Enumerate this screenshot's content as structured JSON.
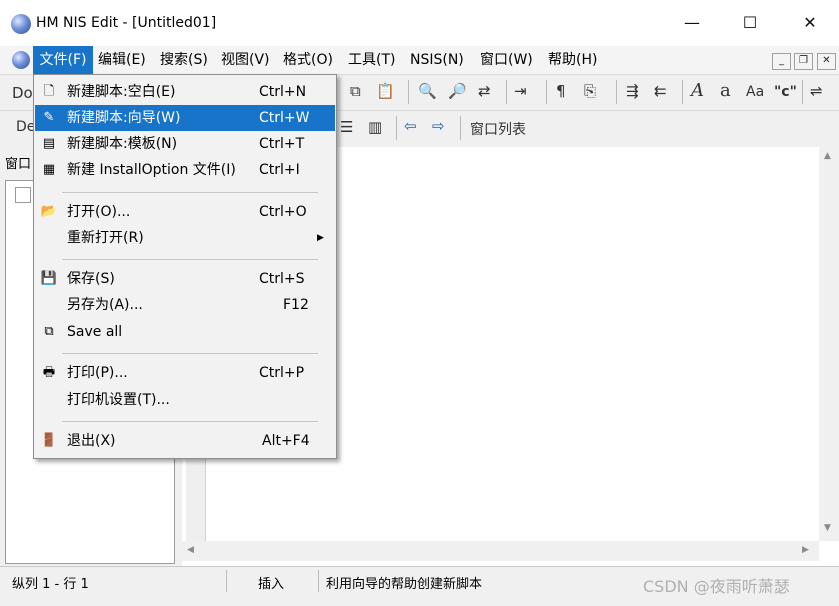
{
  "window": {
    "title": "HM NIS Edit - [Untitled01]",
    "minimize": "—",
    "maximize": "☐",
    "close": "✕"
  },
  "menubar": {
    "items": [
      "文件(F)",
      "编辑(E)",
      "搜索(S)",
      "视图(V)",
      "格式(O)",
      "工具(T)",
      "NSIS(N)",
      "窗口(W)",
      "帮助(H)"
    ],
    "mdi_min": "_",
    "mdi_restore": "❐",
    "mdi_close": "✕"
  },
  "toolbar": {
    "row1_left": "Do",
    "row2_left": "De",
    "window_list": "窗口列表",
    "text_a1": "A",
    "text_a2": "a",
    "text_ab": "Aa",
    "text_quote": "\"c\""
  },
  "left_panel": {
    "title": "窗口"
  },
  "file_menu": {
    "items": [
      {
        "label": "新建脚本:空白(E)",
        "shortcut": "Ctrl+N",
        "icon": "new-file-icon"
      },
      {
        "label": "新建脚本:向导(W)",
        "shortcut": "Ctrl+W",
        "icon": "wizard-wand-icon",
        "highlighted": true
      },
      {
        "label": "新建脚本:模板(N)",
        "shortcut": "Ctrl+T",
        "icon": "template-icon"
      },
      {
        "label": "新建 InstallOption 文件(I)",
        "shortcut": "Ctrl+I",
        "icon": "installoption-file-icon"
      },
      {
        "label": "打开(O)...",
        "shortcut": "Ctrl+O",
        "icon": "open-folder-icon"
      },
      {
        "label": "重新打开(R)",
        "shortcut": "",
        "icon": "",
        "submenu": true
      },
      {
        "label": "保存(S)",
        "shortcut": "Ctrl+S",
        "icon": "save-disk-icon"
      },
      {
        "label": "另存为(A)...",
        "shortcut": "F12",
        "icon": ""
      },
      {
        "label": "Save all",
        "shortcut": "",
        "icon": "save-all-icon"
      },
      {
        "label": "打印(P)...",
        "shortcut": "Ctrl+P",
        "icon": "printer-icon"
      },
      {
        "label": "打印机设置(T)...",
        "shortcut": "",
        "icon": ""
      },
      {
        "label": "退出(X)",
        "shortcut": "Alt+F4",
        "icon": "exit-door-icon"
      }
    ]
  },
  "statusbar": {
    "position": "纵列 1 - 行 1",
    "mode": "插入",
    "hint": "利用向导的帮助创建新脚本"
  },
  "watermark": "CSDN @夜雨听萧瑟"
}
